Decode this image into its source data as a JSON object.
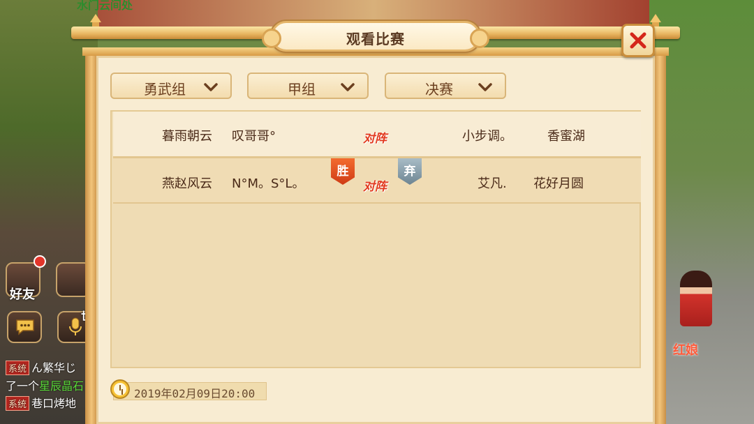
{
  "background": {
    "scene_text": "水门云间处",
    "buttons": [
      {
        "label": "好友",
        "icon": "friends-icon"
      },
      {
        "label": "",
        "icon": "chat-icon"
      },
      {
        "label": "世",
        "icon": "voice-icon"
      }
    ],
    "chat": [
      {
        "tag": "系统",
        "text": "ん繁华じ",
        "highlight": ""
      },
      {
        "tag": "",
        "text": "了一个",
        "highlight": "星辰晶石"
      },
      {
        "tag": "系统",
        "text": "巷口烤地",
        "highlight": ""
      }
    ],
    "npc_name": "红娘"
  },
  "dialog": {
    "title": "观看比赛",
    "close_icon": "close-icon"
  },
  "filters": {
    "group": "勇武组",
    "subgroup": "甲组",
    "stage": "决赛"
  },
  "matches": [
    {
      "left_team": [
        "暮雨朝云",
        "叹哥哥°"
      ],
      "vs": "对阵",
      "right_team": [
        "小步调。",
        "香蜜湖"
      ],
      "left_result": "",
      "right_result": ""
    },
    {
      "left_team": [
        "燕赵风云",
        "N°M。S°L。"
      ],
      "vs": "对阵",
      "right_team": [
        "艾凡.",
        "花好月圆"
      ],
      "left_result": "胜",
      "right_result": "弃"
    }
  ],
  "footer": {
    "date": "2019年02月09日20:00",
    "clock_icon": "clock-icon"
  },
  "colors": {
    "vs_text": "#e23a1f",
    "win_badge": "#e14a1f",
    "forfeit_badge": "#8ea3ae",
    "close_x": "#d4261a"
  }
}
